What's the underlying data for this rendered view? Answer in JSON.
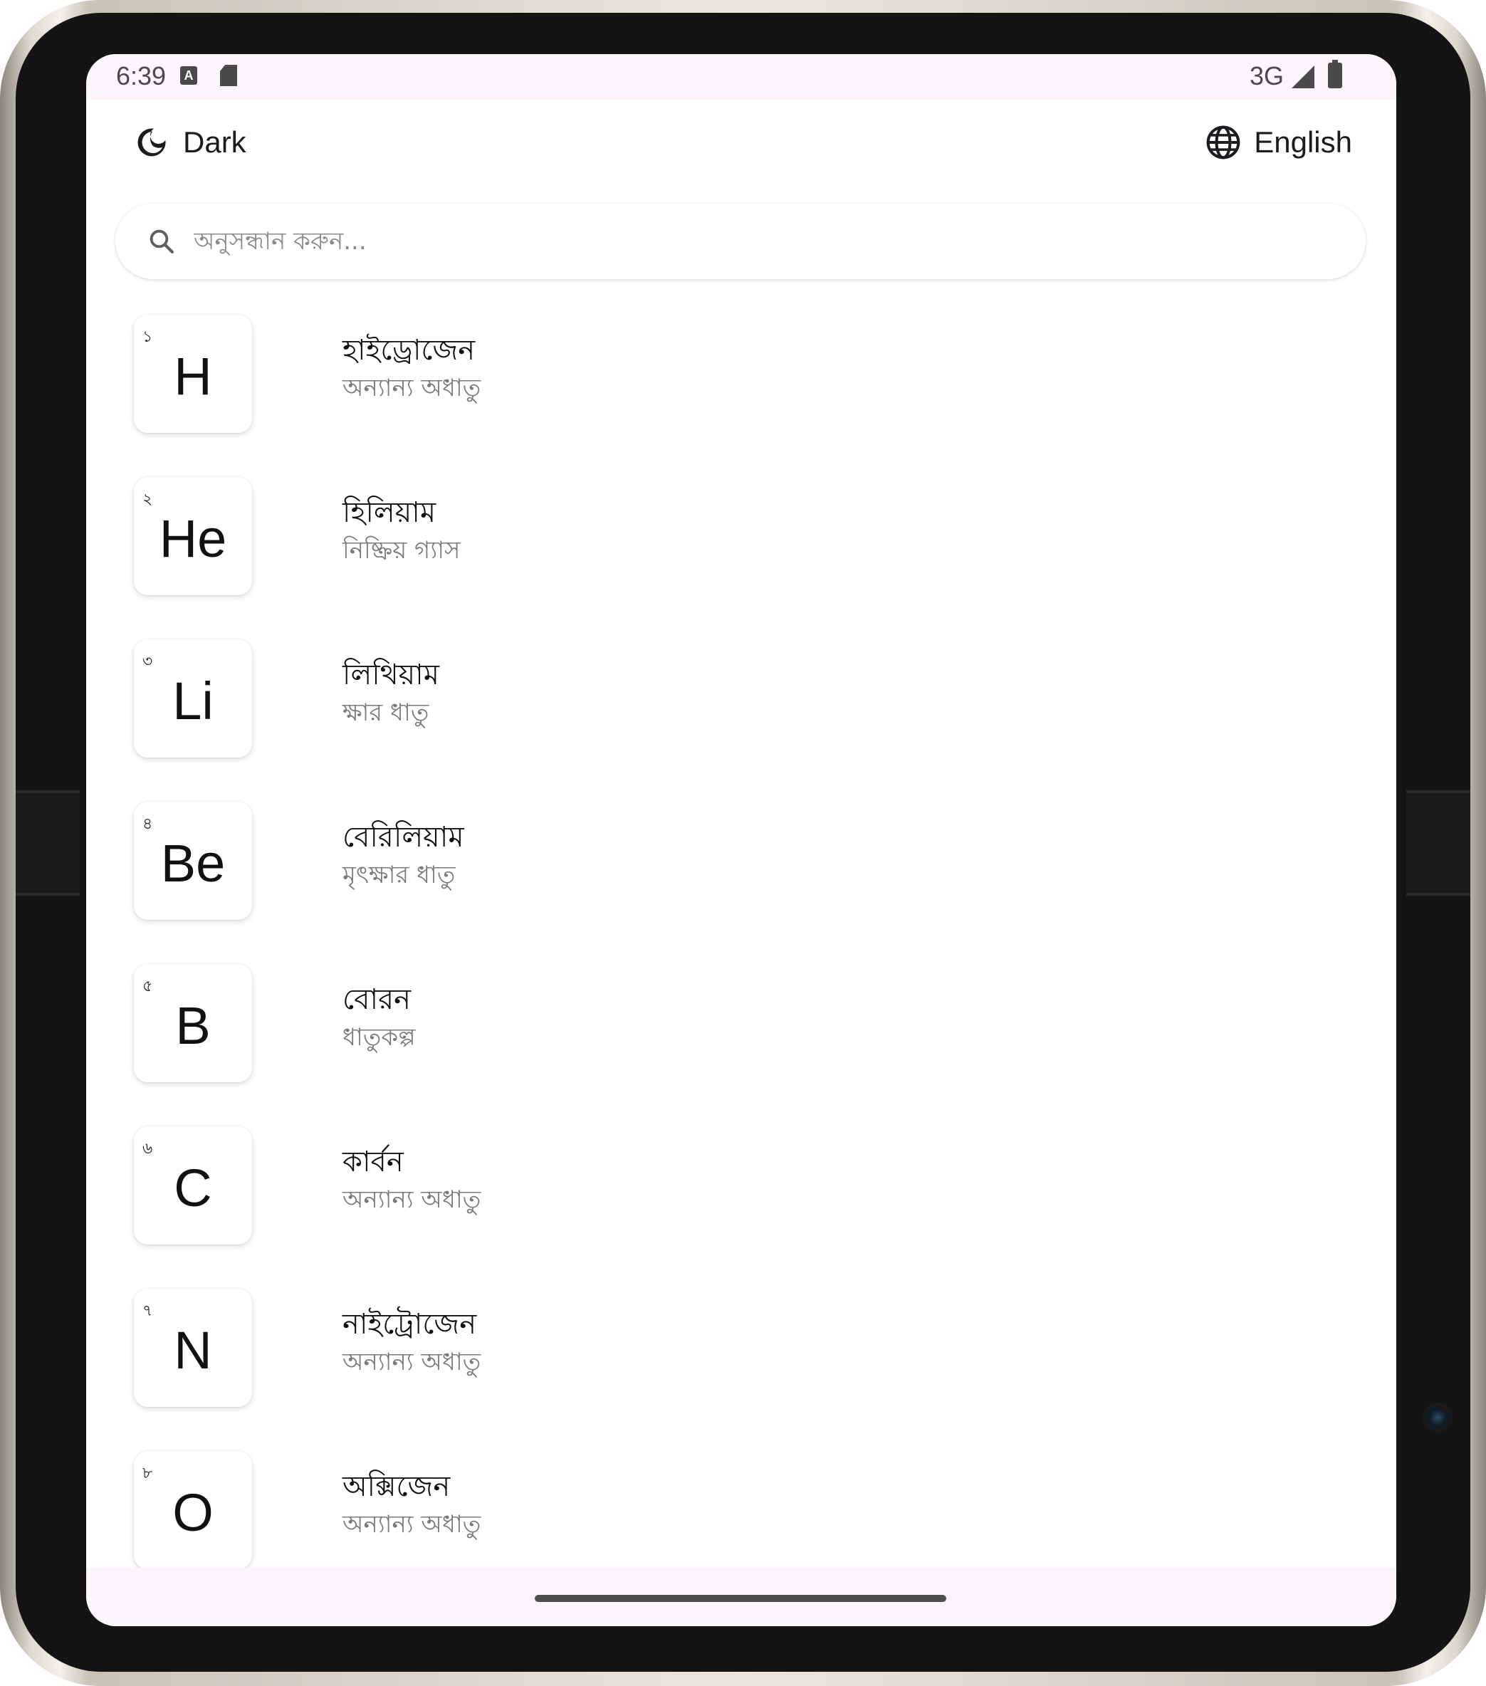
{
  "status_bar": {
    "time": "6:39",
    "network": "3G",
    "icons": [
      "keyboard-a-icon",
      "sd-card-icon",
      "signal-icon",
      "battery-icon"
    ]
  },
  "header": {
    "theme_label": "Dark",
    "theme_icon": "moon-icon",
    "language_label": "English",
    "language_icon": "globe-icon"
  },
  "search": {
    "placeholder": "অনুসন্ধান করুন...",
    "icon": "search-icon"
  },
  "elements": [
    {
      "number": "১",
      "symbol": "H",
      "name": "হাইড্রোজেন",
      "category": "অন্যান্য অধাতু"
    },
    {
      "number": "২",
      "symbol": "He",
      "name": "হিলিয়াম",
      "category": "নিষ্ক্রিয় গ্যাস"
    },
    {
      "number": "৩",
      "symbol": "Li",
      "name": "লিথিয়াম",
      "category": "ক্ষার ধাতু"
    },
    {
      "number": "৪",
      "symbol": "Be",
      "name": "বেরিলিয়াম",
      "category": "মৃৎক্ষার ধাতু"
    },
    {
      "number": "৫",
      "symbol": "B",
      "name": "বোরন",
      "category": "ধাতুকল্প"
    },
    {
      "number": "৬",
      "symbol": "C",
      "name": "কার্বন",
      "category": "অন্যান্য অধাতু"
    },
    {
      "number": "৭",
      "symbol": "N",
      "name": "নাইট্রোজেন",
      "category": "অন্যান্য অধাতু"
    },
    {
      "number": "৮",
      "symbol": "O",
      "name": "অক্সিজেন",
      "category": "অন্যান্য অধাতু"
    }
  ]
}
